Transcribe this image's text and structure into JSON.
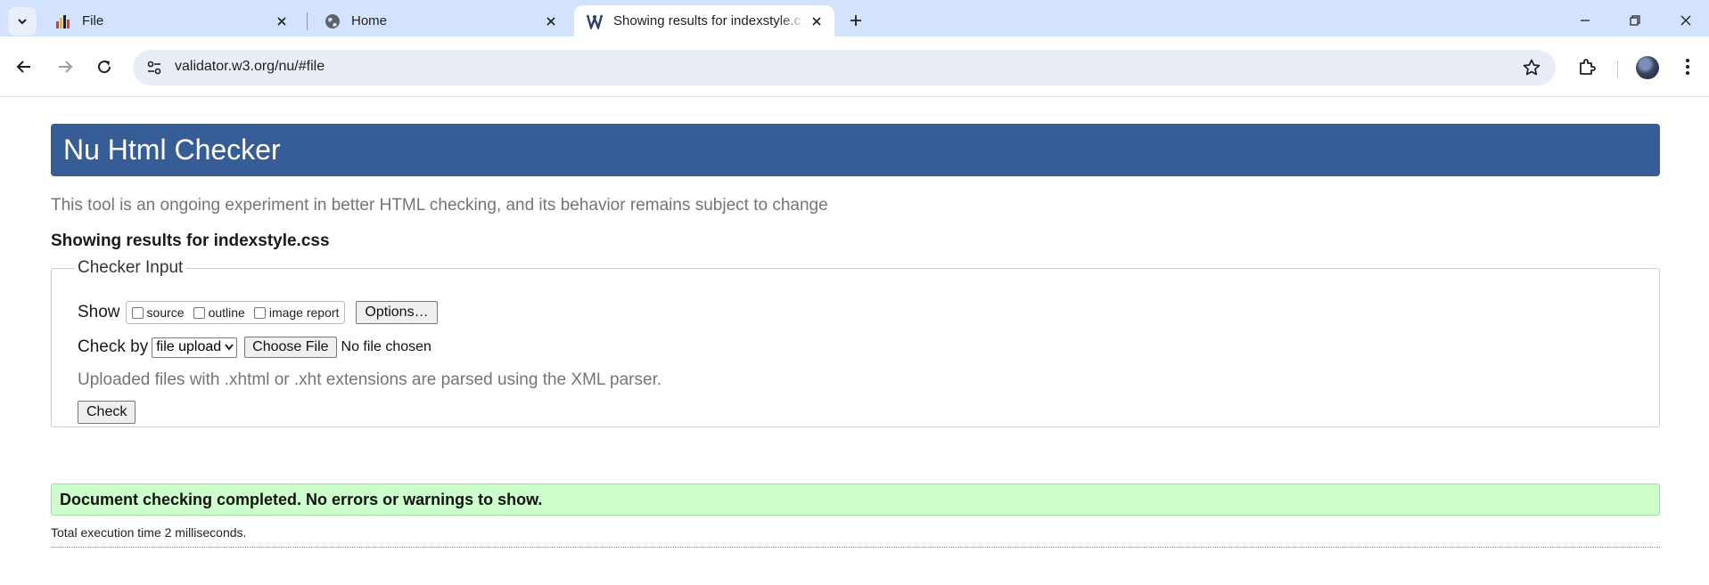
{
  "browser": {
    "tabs": [
      {
        "title": "File",
        "icon": "bar-chart-favicon"
      },
      {
        "title": "Home",
        "icon": "globe-icon"
      },
      {
        "title": "Showing results for indexstyle.c",
        "icon": "w3c-validator-favicon",
        "active": true
      }
    ],
    "url": "validator.w3.org/nu/#file"
  },
  "page": {
    "banner_title": "Nu Html Checker",
    "subtitle": "This tool is an ongoing experiment in better HTML checking, and its behavior remains subject to change",
    "results_heading": "Showing results for indexstyle.css",
    "checker_input": {
      "legend": "Checker Input",
      "show_label": "Show",
      "show_options": [
        "source",
        "outline",
        "image report"
      ],
      "options_button": "Options…",
      "check_by_label": "Check by",
      "check_by_selected": "file upload",
      "choose_file_button": "Choose File",
      "no_file_text": "No file chosen",
      "note": "Uploaded files with .xhtml or .xht extensions are parsed using the XML parser.",
      "check_button": "Check"
    },
    "success_message": "Document checking completed. No errors or warnings to show.",
    "execution_time": "Total execution time 2 milliseconds."
  },
  "colors": {
    "banner": "#365d95",
    "success_bg": "#ccffcc",
    "tabstrip": "#d3e3fd"
  }
}
